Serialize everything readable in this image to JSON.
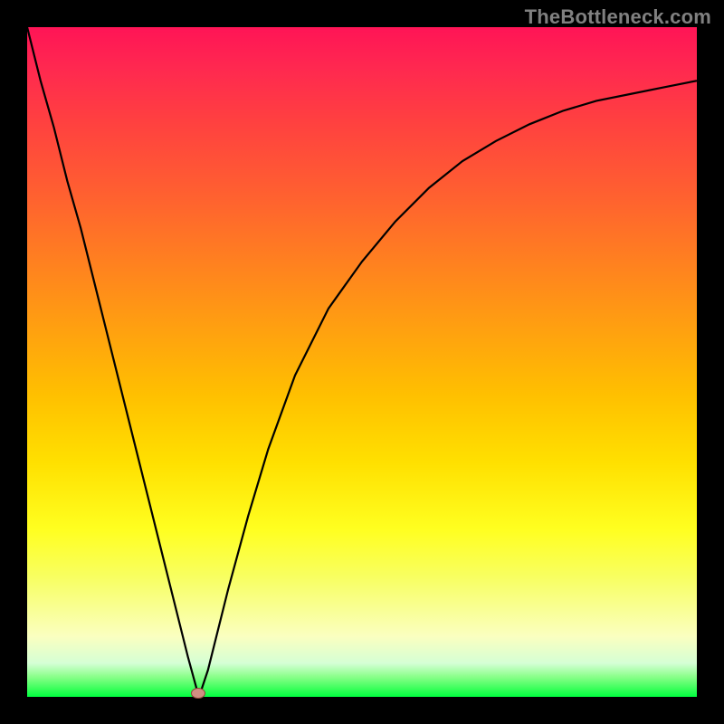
{
  "watermark": "TheBottleneck.com",
  "colors": {
    "frame": "#000000",
    "curve": "#000000",
    "marker_fill": "#d18e82",
    "marker_stroke": "#904538",
    "gradient_top": "#ff1456",
    "gradient_bottom": "#00ff40"
  },
  "chart_data": {
    "type": "line",
    "title": "",
    "xlabel": "",
    "ylabel": "",
    "xlim": [
      0,
      100
    ],
    "ylim": [
      0,
      100
    ],
    "grid": false,
    "legend": false,
    "x": [
      0,
      2,
      4,
      6,
      8,
      10,
      12,
      14,
      16,
      18,
      20,
      22,
      24,
      25.5,
      26,
      27,
      28,
      30,
      33,
      36,
      40,
      45,
      50,
      55,
      60,
      65,
      70,
      75,
      80,
      85,
      90,
      95,
      100
    ],
    "y": [
      100,
      92,
      85,
      77,
      70,
      62,
      54,
      46,
      38,
      30,
      22,
      14,
      6,
      0.5,
      1,
      4,
      8,
      16,
      27,
      37,
      48,
      58,
      65,
      71,
      76,
      80,
      83,
      85.5,
      87.5,
      89,
      90,
      91,
      92
    ],
    "marker": {
      "x": 25.5,
      "y": 0.5
    },
    "annotations": []
  }
}
